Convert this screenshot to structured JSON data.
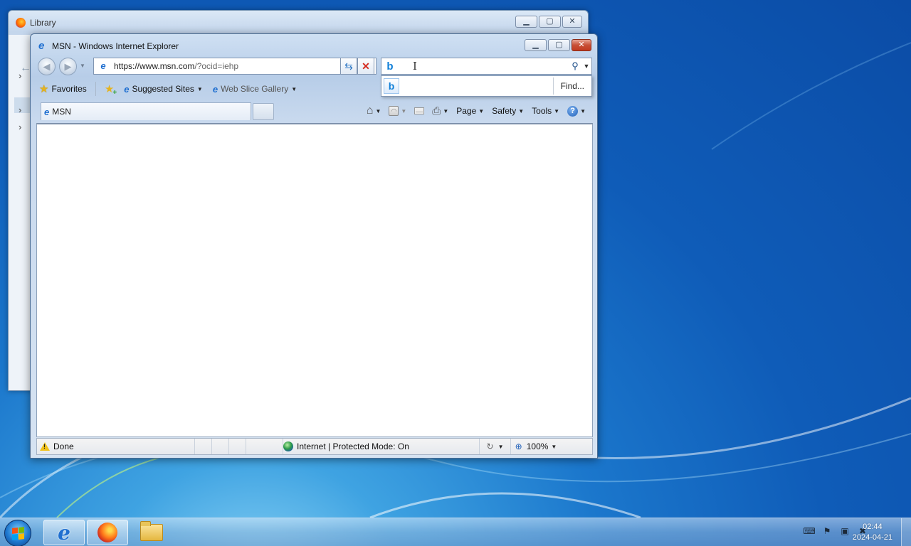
{
  "library_window": {
    "title": "Library"
  },
  "ie_window": {
    "title": "MSN - Windows Internet Explorer",
    "address": {
      "url_host": "https://www.msn.com",
      "url_path": "/?ocid=iehp"
    },
    "search": {
      "value": "",
      "find_label": "Find..."
    },
    "favorites_bar": {
      "favorites_label": "Favorites",
      "suggested_sites_label": "Suggested Sites",
      "web_slice_label": "Web Slice Gallery"
    },
    "tab": {
      "label": "MSN"
    },
    "command_bar": {
      "page_label": "Page",
      "safety_label": "Safety",
      "tools_label": "Tools"
    },
    "status_bar": {
      "status_text": "Done",
      "zone_text": "Internet | Protected Mode: On",
      "zoom_text": "100%"
    }
  },
  "taskbar": {
    "clock_time": "02:44",
    "clock_date": "2024-04-21"
  },
  "colors": {
    "desktop": "#0f5cb8",
    "ie_frame": "#b7cde8",
    "close_button": "#c74f36"
  }
}
